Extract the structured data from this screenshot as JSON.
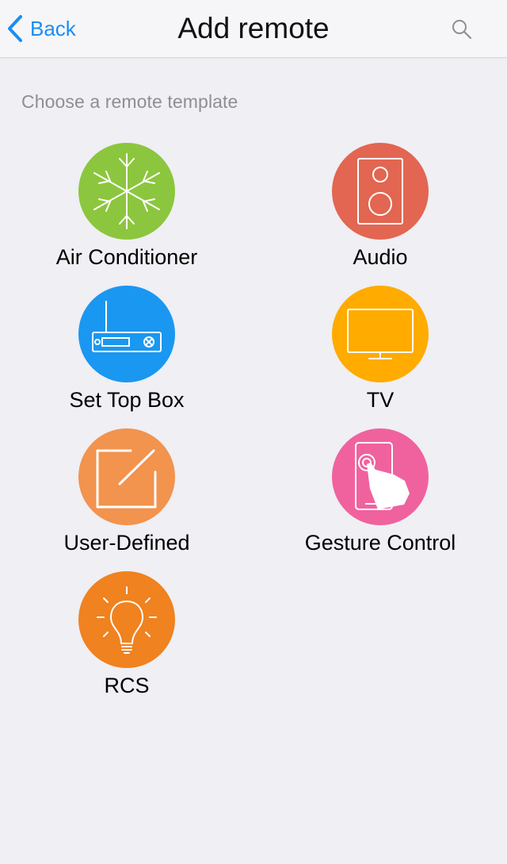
{
  "header": {
    "back_label": "Back",
    "title": "Add remote",
    "back_icon": "chevron-left-icon",
    "search_icon": "search-icon"
  },
  "subtitle": "Choose a remote template",
  "templates": [
    {
      "label": "Air Conditioner",
      "color": "#8cc63e",
      "icon": "snowflake-icon"
    },
    {
      "label": "Audio",
      "color": "#e26652",
      "icon": "speaker-icon"
    },
    {
      "label": "Set Top Box",
      "color": "#1a97f1",
      "icon": "set-top-box-icon"
    },
    {
      "label": "TV",
      "color": "#ffab00",
      "icon": "tv-icon"
    },
    {
      "label": "User-Defined",
      "color": "#f2934e",
      "icon": "edit-icon"
    },
    {
      "label": "Gesture Control",
      "color": "#f0629e",
      "icon": "gesture-touch-icon"
    },
    {
      "label": "RCS",
      "color": "#f0821f",
      "icon": "light-bulb-icon"
    }
  ]
}
